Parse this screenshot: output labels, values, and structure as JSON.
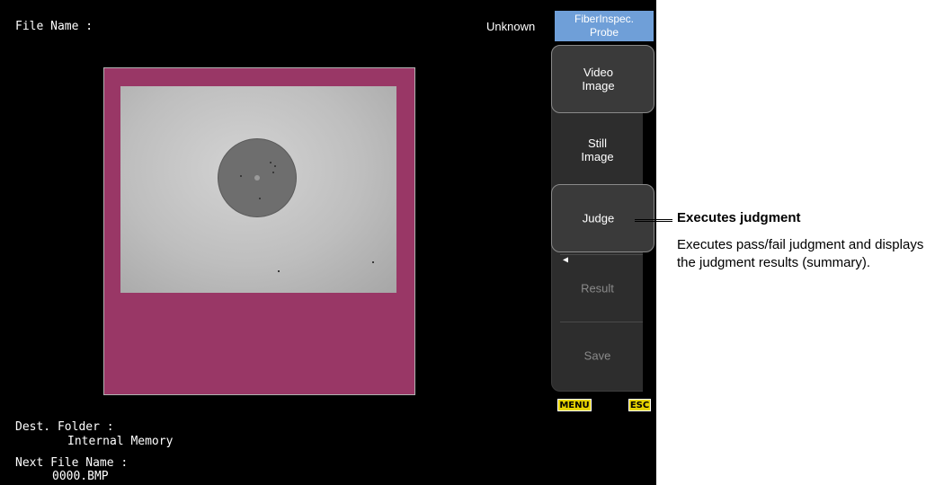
{
  "header": {
    "file_name_label": "File Name :",
    "file_name_value": "Unknown",
    "mode_chip_line1": "FiberInspec.",
    "mode_chip_line2": "Probe"
  },
  "footer": {
    "dest_folder_label": "Dest. Folder :",
    "dest_folder_value": "Internal Memory",
    "next_file_label": "Next File Name :",
    "next_file_value": "0000.BMP"
  },
  "softkeys": [
    {
      "line1": "Video",
      "line2": "Image"
    },
    {
      "line1": "Still",
      "line2": "Image"
    },
    {
      "line1": "Judge",
      "line2": ""
    },
    {
      "line1": "Result",
      "line2": ""
    },
    {
      "line1": "Save",
      "line2": ""
    }
  ],
  "keys": {
    "menu": "MENU",
    "esc": "ESC"
  },
  "callout": {
    "title": "Executes judgment",
    "description": "Executes pass/fail judgment and displays the judgment results (summary)."
  },
  "colors": {
    "screen_bg": "#000000",
    "frame_magenta": "#993766",
    "mode_chip_blue": "#6f9fd8",
    "key_yellow": "#e6d300"
  }
}
